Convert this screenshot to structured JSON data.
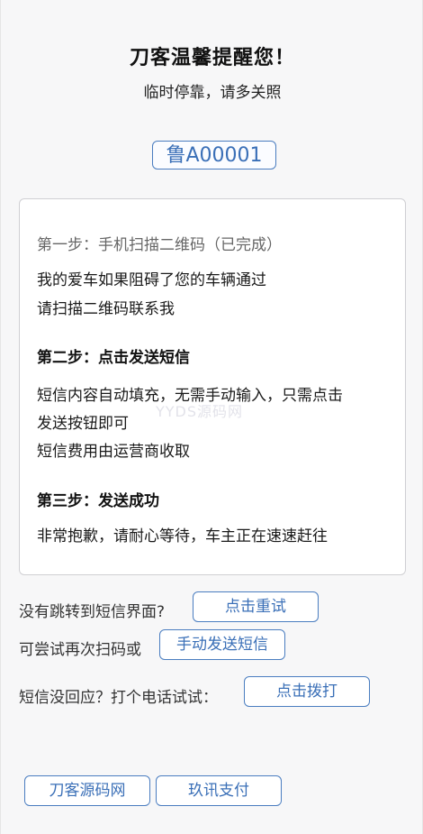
{
  "header": {
    "title": "刀客温馨提醒您！",
    "subtitle": "临时停靠，请多关照"
  },
  "plate": {
    "number": "鲁A00001"
  },
  "steps": {
    "step1_title": "第一步：手机扫描二维码（已完成）",
    "step1_line1": "我的爱车如果阻碍了您的车辆通过",
    "step1_line2": "请扫描二维码联系我",
    "step2_title": "第二步：点击发送短信",
    "step2_line1": "短信内容自动填充，无需手动输入，只需点击",
    "step2_line2": "发送按钮即可",
    "step2_line3": "短信费用由运营商收取",
    "step3_title": "第三步：发送成功",
    "step3_line1": "非常抱歉，请耐心等待，车主正在速速赶往"
  },
  "watermark": "YYDS源码网",
  "actions": {
    "no_redirect_text": "没有跳转到短信界面?",
    "retry_label": "点击重试",
    "rescan_text": "可尝试再次扫码或",
    "manual_sms_label": "手动发送短信",
    "no_reply_text": "短信没回应？打个电话试试：",
    "call_label": "点击拨打"
  },
  "footer": {
    "site_label": "刀客源码网",
    "pay_label": "玖讯支付"
  },
  "colors": {
    "accent": "#3a6fb7",
    "border": "#4a7dc0"
  }
}
